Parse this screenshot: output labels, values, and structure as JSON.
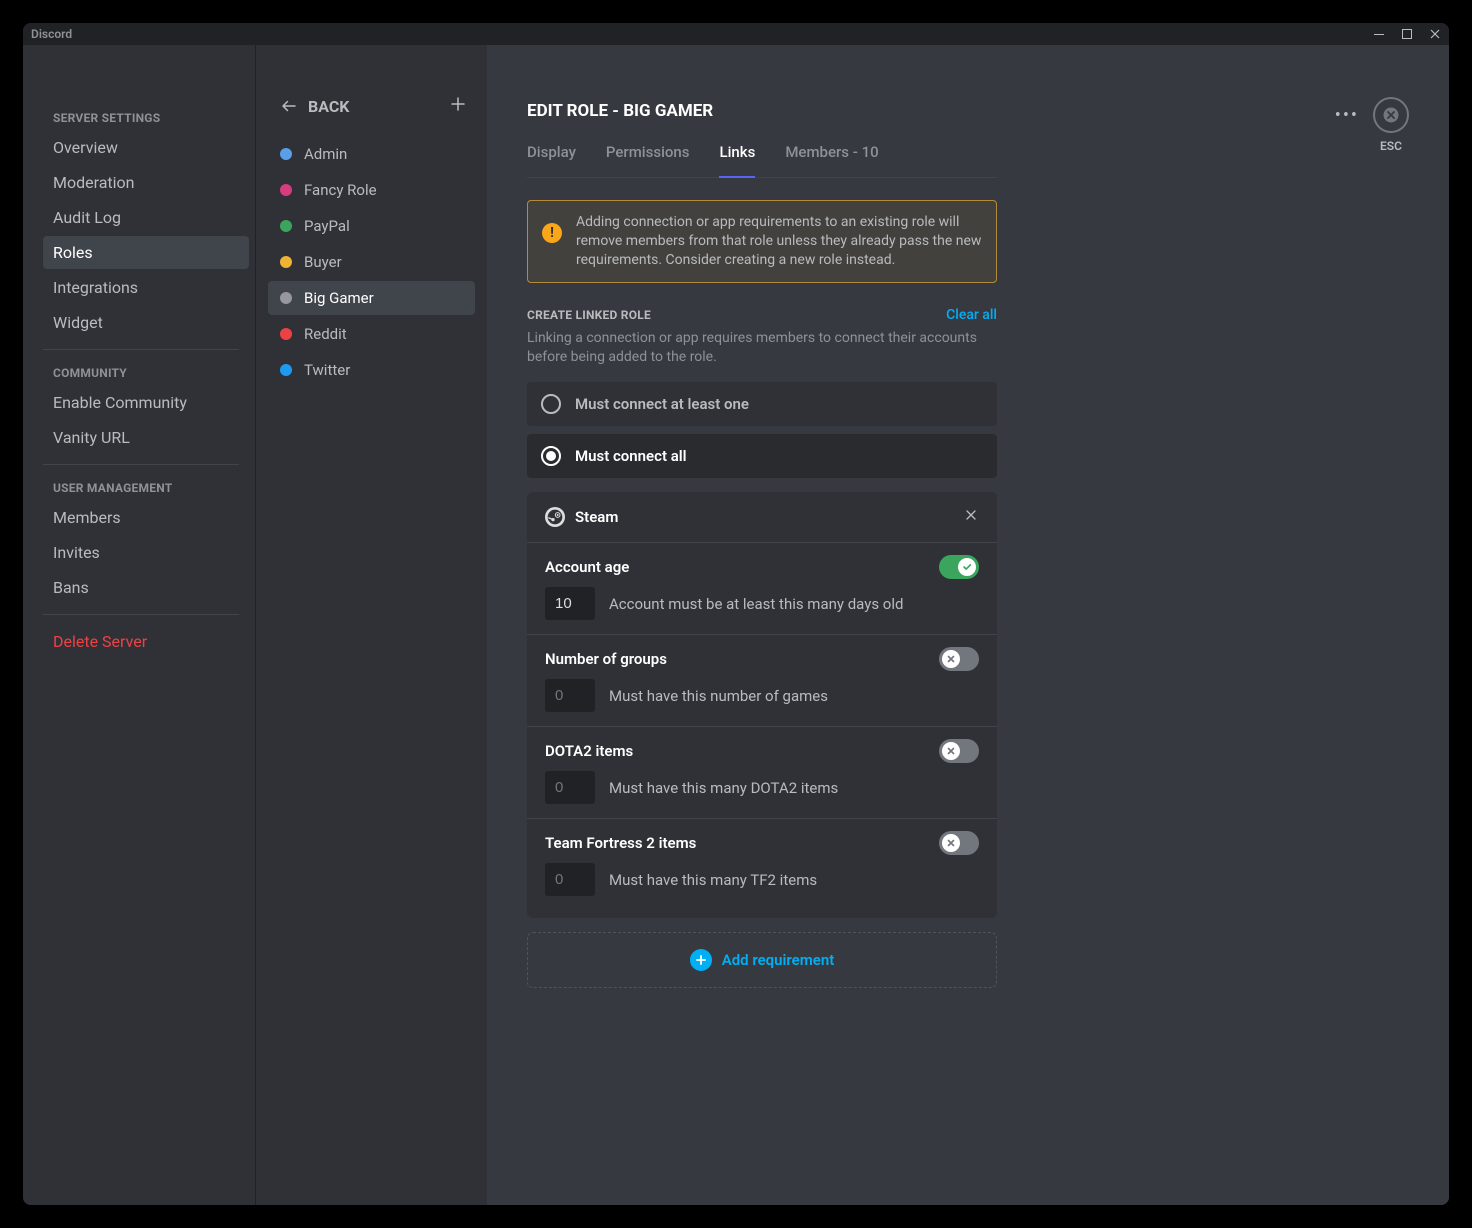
{
  "titlebar": {
    "app_name": "Discord"
  },
  "sidebar": {
    "cat_server": "SERVER SETTINGS",
    "overview": "Overview",
    "moderation": "Moderation",
    "audit_log": "Audit Log",
    "roles": "Roles",
    "integrations": "Integrations",
    "widget": "Widget",
    "cat_community": "COMMUNITY",
    "enable_community": "Enable Community",
    "vanity_url": "Vanity URL",
    "cat_user_mgmt": "USER MANAGEMENT",
    "members": "Members",
    "invites": "Invites",
    "bans": "Bans",
    "delete_server": "Delete Server"
  },
  "roles_col": {
    "back_label": "BACK",
    "items": [
      {
        "name": "Admin",
        "color": "#5a9fe8"
      },
      {
        "name": "Fancy Role",
        "color": "#d83c7f"
      },
      {
        "name": "PayPal",
        "color": "#3ba55c"
      },
      {
        "name": "Buyer",
        "color": "#f0b232"
      },
      {
        "name": "Big Gamer",
        "color": "#96989d"
      },
      {
        "name": "Reddit",
        "color": "#ed4245"
      },
      {
        "name": "Twitter",
        "color": "#1d9bf0"
      }
    ]
  },
  "close": {
    "esc": "ESC"
  },
  "main": {
    "title_prefix": "EDIT ROLE  -  ",
    "role_name": "BIG GAMER",
    "tabs": {
      "display": "Display",
      "permissions": "Permissions",
      "links": "Links",
      "members": "Members - 10"
    },
    "warning": "Adding connection or app requirements to an existing role will remove members from that role unless they already pass the new requirements. Consider creating a new role instead.",
    "section": {
      "title": "CREATE LINKED ROLE",
      "clear_all": "Clear all",
      "desc": "Linking a connection or app requires members to connect their accounts before being added to the role."
    },
    "radio": {
      "at_least_one": "Must connect at least one",
      "all": "Must connect all"
    },
    "connection": {
      "name": "Steam",
      "reqs": [
        {
          "title": "Account age",
          "value": "10",
          "enabled": true,
          "desc": "Account must be at least this many days old"
        },
        {
          "title": "Number of groups",
          "value": "0",
          "enabled": false,
          "desc": "Must have this number of games"
        },
        {
          "title": "DOTA2 items",
          "value": "0",
          "enabled": false,
          "desc": "Must have this many DOTA2 items"
        },
        {
          "title": "Team Fortress 2 items",
          "value": "0",
          "enabled": false,
          "desc": "Must have this many TF2 items"
        }
      ]
    },
    "add_requirement": "Add requirement"
  }
}
